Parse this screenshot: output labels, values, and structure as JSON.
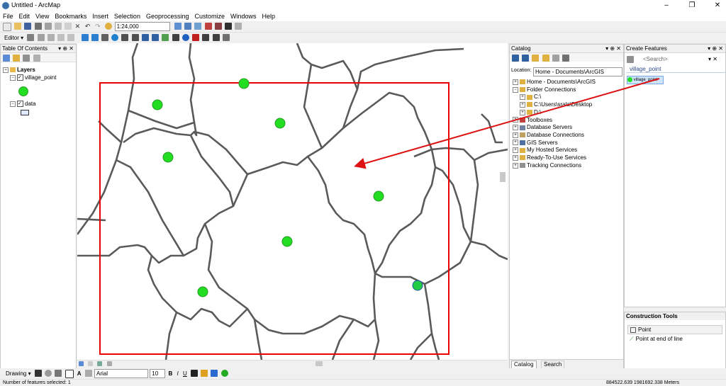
{
  "window": {
    "title": "Untitled - ArcMap",
    "controls": [
      "–",
      "❐",
      "✕"
    ]
  },
  "menu": [
    "File",
    "Edit",
    "View",
    "Bookmarks",
    "Insert",
    "Selection",
    "Geoprocessing",
    "Customize",
    "Windows",
    "Help"
  ],
  "toolbar": {
    "scale": "1:24,000",
    "editor_label": "Editor ▾"
  },
  "toc": {
    "title": "Table Of Contents",
    "layers_label": "Layers",
    "layer1": "village_point",
    "layer2": "data"
  },
  "catalog": {
    "title": "Catalog",
    "location_label": "Location:",
    "location_value": "Home - Documents\\ArcGIS",
    "items": [
      {
        "label": "Home - Documents\\ArcGIS",
        "level": 0
      },
      {
        "label": "Folder Connections",
        "level": 0
      },
      {
        "label": "C:\\",
        "level": 1
      },
      {
        "label": "C:\\Users\\srala\\Desktop",
        "level": 1
      },
      {
        "label": "D:\\",
        "level": 1
      },
      {
        "label": "Toolboxes",
        "level": 0
      },
      {
        "label": "Database Servers",
        "level": 0
      },
      {
        "label": "Database Connections",
        "level": 0
      },
      {
        "label": "GIS Servers",
        "level": 0
      },
      {
        "label": "My Hosted Services",
        "level": 0
      },
      {
        "label": "Ready-To-Use Services",
        "level": 0
      },
      {
        "label": "Tracking Connections",
        "level": 0
      }
    ],
    "tab_catalog": "Catalog",
    "tab_search": "Search"
  },
  "create_features": {
    "title": "Create Features",
    "search_placeholder": "<Search>",
    "group": "village_point",
    "template": "village_point"
  },
  "construction_tools": {
    "title": "Construction Tools",
    "tools": [
      "Point",
      "Point at end of line"
    ]
  },
  "drawing": {
    "label": "Drawing ▾",
    "font": "Arial",
    "size": "10",
    "bold": "B",
    "italic": "I",
    "underline": "U"
  },
  "status": {
    "left": "Number of features selected: 1",
    "coords": "884522.639  1981692.338 Meters"
  },
  "colors": {
    "point_fill": "#22dd22",
    "boundary": "#5a5a5a",
    "selection_box": "#ee0000",
    "arrow": "#dd1111"
  }
}
